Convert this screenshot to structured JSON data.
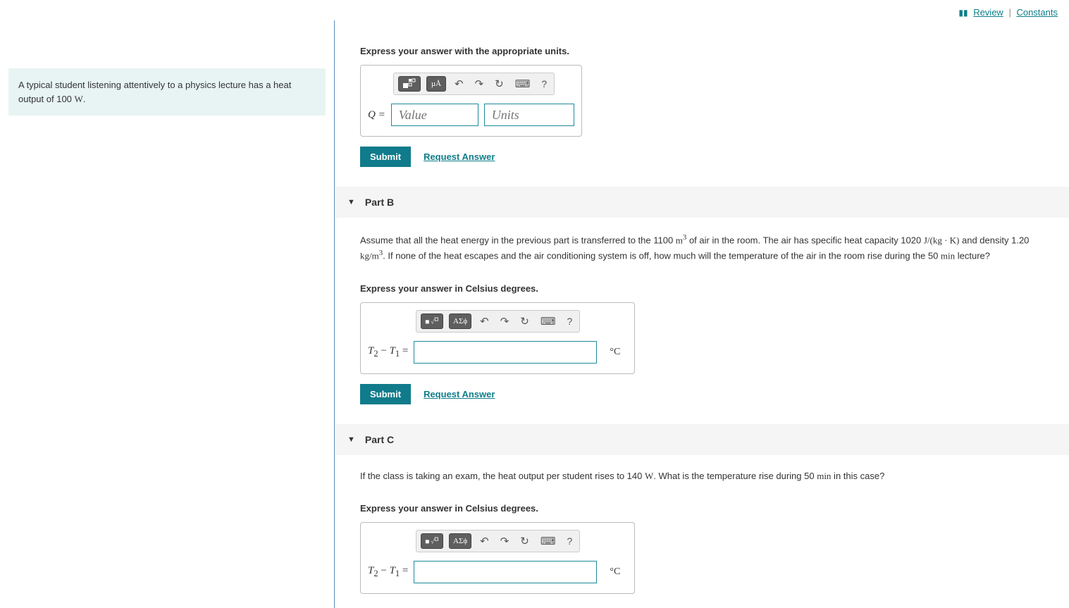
{
  "topLinks": {
    "review": "Review",
    "constants": "Constants"
  },
  "problem": {
    "text_a": "A typical student listening attentively to a physics lecture has a heat output of 100 ",
    "text_b": "W",
    "text_c": "."
  },
  "partA": {
    "instruction": "Express your answer with the appropriate units.",
    "toolbar": {
      "fmtBtn": "fmt",
      "unitBtn": "µÅ",
      "undo": "↶",
      "redo": "↷",
      "reset": "↻",
      "keyboard": "⌨",
      "help": "?"
    },
    "label": "Q =",
    "valuePlaceholder": "Value",
    "unitsPlaceholder": "Units",
    "submit": "Submit",
    "request": "Request Answer"
  },
  "partB": {
    "title": "Part B",
    "q1": "Assume that all the heat energy in the previous part is transferred to the 1100 ",
    "q2": "m",
    "q3": " of air in the room. The air has specific heat capacity 1020 ",
    "q4": "J/(kg · K)",
    "q5": " and density 1.20 ",
    "q6": "kg/m",
    "q7": ". If none of the heat escapes and the air conditioning system is off, how much will the temperature of the air in the room rise during the 50 ",
    "q8": "min",
    "q9": " lecture?",
    "instruction": "Express your answer in Celsius degrees.",
    "toolbar": {
      "fmtBtn": "fmt",
      "greekBtn": "ΑΣϕ",
      "undo": "↶",
      "redo": "↷",
      "reset": "↻",
      "keyboard": "⌨",
      "help": "?"
    },
    "label": "T₂ − T₁ =",
    "unitSuffix": "°C",
    "submit": "Submit",
    "request": "Request Answer"
  },
  "partC": {
    "title": "Part C",
    "q1": "If the class is taking an exam, the heat output per student rises to 140 ",
    "q2": "W",
    "q3": ". What is the temperature rise during 50 ",
    "q4": "min",
    "q5": " in this case?",
    "instruction": "Express your answer in Celsius degrees.",
    "toolbar": {
      "fmtBtn": "fmt",
      "greekBtn": "ΑΣϕ",
      "undo": "↶",
      "redo": "↷",
      "reset": "↻",
      "keyboard": "⌨",
      "help": "?"
    },
    "label": "T₂ − T₁ =",
    "unitSuffix": "°C"
  }
}
